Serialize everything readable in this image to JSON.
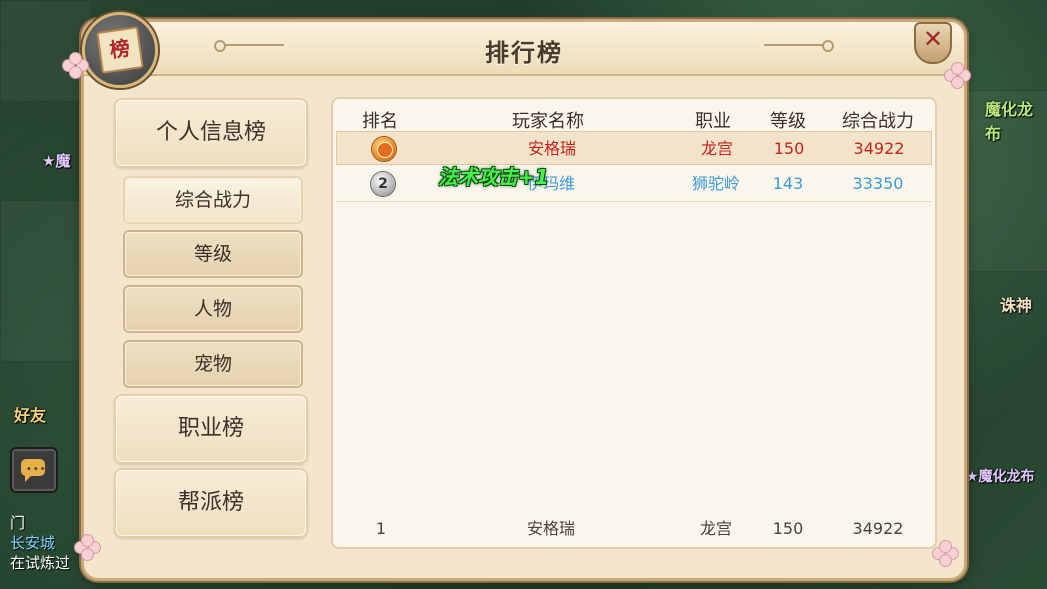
{
  "window": {
    "title": "排行榜",
    "badge_char": "榜",
    "close_label": "✕"
  },
  "nav": {
    "main_items": [
      "个人信息榜",
      "职业榜",
      "帮派榜"
    ],
    "sub_items": [
      "综合战力",
      "等级",
      "人物",
      "宠物"
    ],
    "active_sub": "综合战力"
  },
  "table": {
    "headers": [
      "排名",
      "玩家名称",
      "职业",
      "等级",
      "综合战力"
    ],
    "rows": [
      {
        "rank": "1",
        "name": "安格瑞",
        "class": "龙宫",
        "level": "150",
        "power": "34922"
      },
      {
        "rank": "2",
        "name": "伊玛维",
        "class": "狮驼岭",
        "level": "143",
        "power": "33350"
      }
    ],
    "own_rank": {
      "rank": "1",
      "name": "安格瑞",
      "class": "龙宫",
      "level": "150",
      "power": "34922"
    }
  },
  "floating_text": "法术攻击+1",
  "world": {
    "labels": [
      "魔化龙布",
      "★魔",
      "诛神",
      "★魔化龙布",
      "好友"
    ],
    "chat_lines": [
      "门",
      "长安城",
      "在试炼过"
    ]
  },
  "colors": {
    "rank1": "#c8201e",
    "rank2": "#3a9ad9",
    "floating": "#48f24a"
  }
}
